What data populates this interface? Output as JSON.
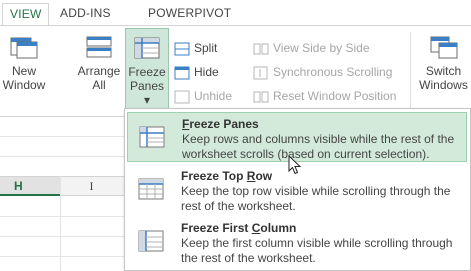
{
  "tabs": [
    {
      "label": "VIEW"
    },
    {
      "label": "ADD-INS"
    },
    {
      "label": "POWERPIVOT"
    }
  ],
  "ribbon": {
    "new_window": {
      "line1": "New",
      "line2": "Window"
    },
    "arrange_all": {
      "line1": "Arrange",
      "line2": "All"
    },
    "freeze_panes": {
      "line1": "Freeze",
      "line2": "Panes ▾"
    },
    "split": "Split",
    "hide": "Hide",
    "unhide": "Unhide",
    "view_side_by_side": "View Side by Side",
    "synchronous_scrolling": "Synchronous Scrolling",
    "reset_window_position": "Reset Window Position",
    "switch_windows": {
      "line1": "Switch",
      "line2": "Windows"
    }
  },
  "sheet": {
    "columns": [
      "H",
      "I"
    ]
  },
  "menu": {
    "items": [
      {
        "title_underlined": "F",
        "title_rest": "reeze Panes",
        "description": "Keep rows and columns visible while the rest of the worksheet scrolls (based on current selection)."
      },
      {
        "title_pre": "Freeze Top ",
        "title_underlined": "R",
        "title_rest": "ow",
        "description": "Keep the top row visible while scrolling through the rest of the worksheet."
      },
      {
        "title_pre": "Freeze First ",
        "title_underlined": "C",
        "title_rest": "olumn",
        "description": "Keep the first column visible while scrolling through the rest of the worksheet."
      }
    ]
  },
  "colors": {
    "accent": "#217346",
    "highlight": "#d3eadb"
  }
}
